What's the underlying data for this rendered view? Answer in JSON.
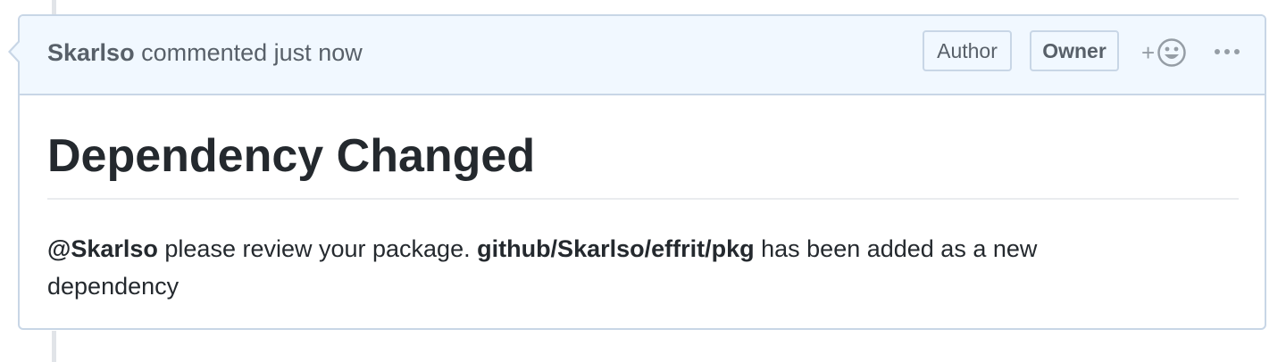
{
  "comment": {
    "author": "Skarlso",
    "action": "commented",
    "time": "just now",
    "badges": {
      "author": "Author",
      "owner": "Owner"
    },
    "reaction_plus": "+",
    "title": "Dependency Changed",
    "body": {
      "mention": "@Skarlso",
      "text_1": " please review your package. ",
      "package": "github/Skarlso/effrit/pkg",
      "text_2": " has been added as a new dependency"
    }
  },
  "icons": {
    "reaction": "smiley-icon",
    "more": "kebab-horizontal-icon"
  },
  "colors": {
    "header_bg": "#f1f8ff",
    "border": "#c8d6e6",
    "muted_text": "#586069",
    "text": "#24292e"
  }
}
